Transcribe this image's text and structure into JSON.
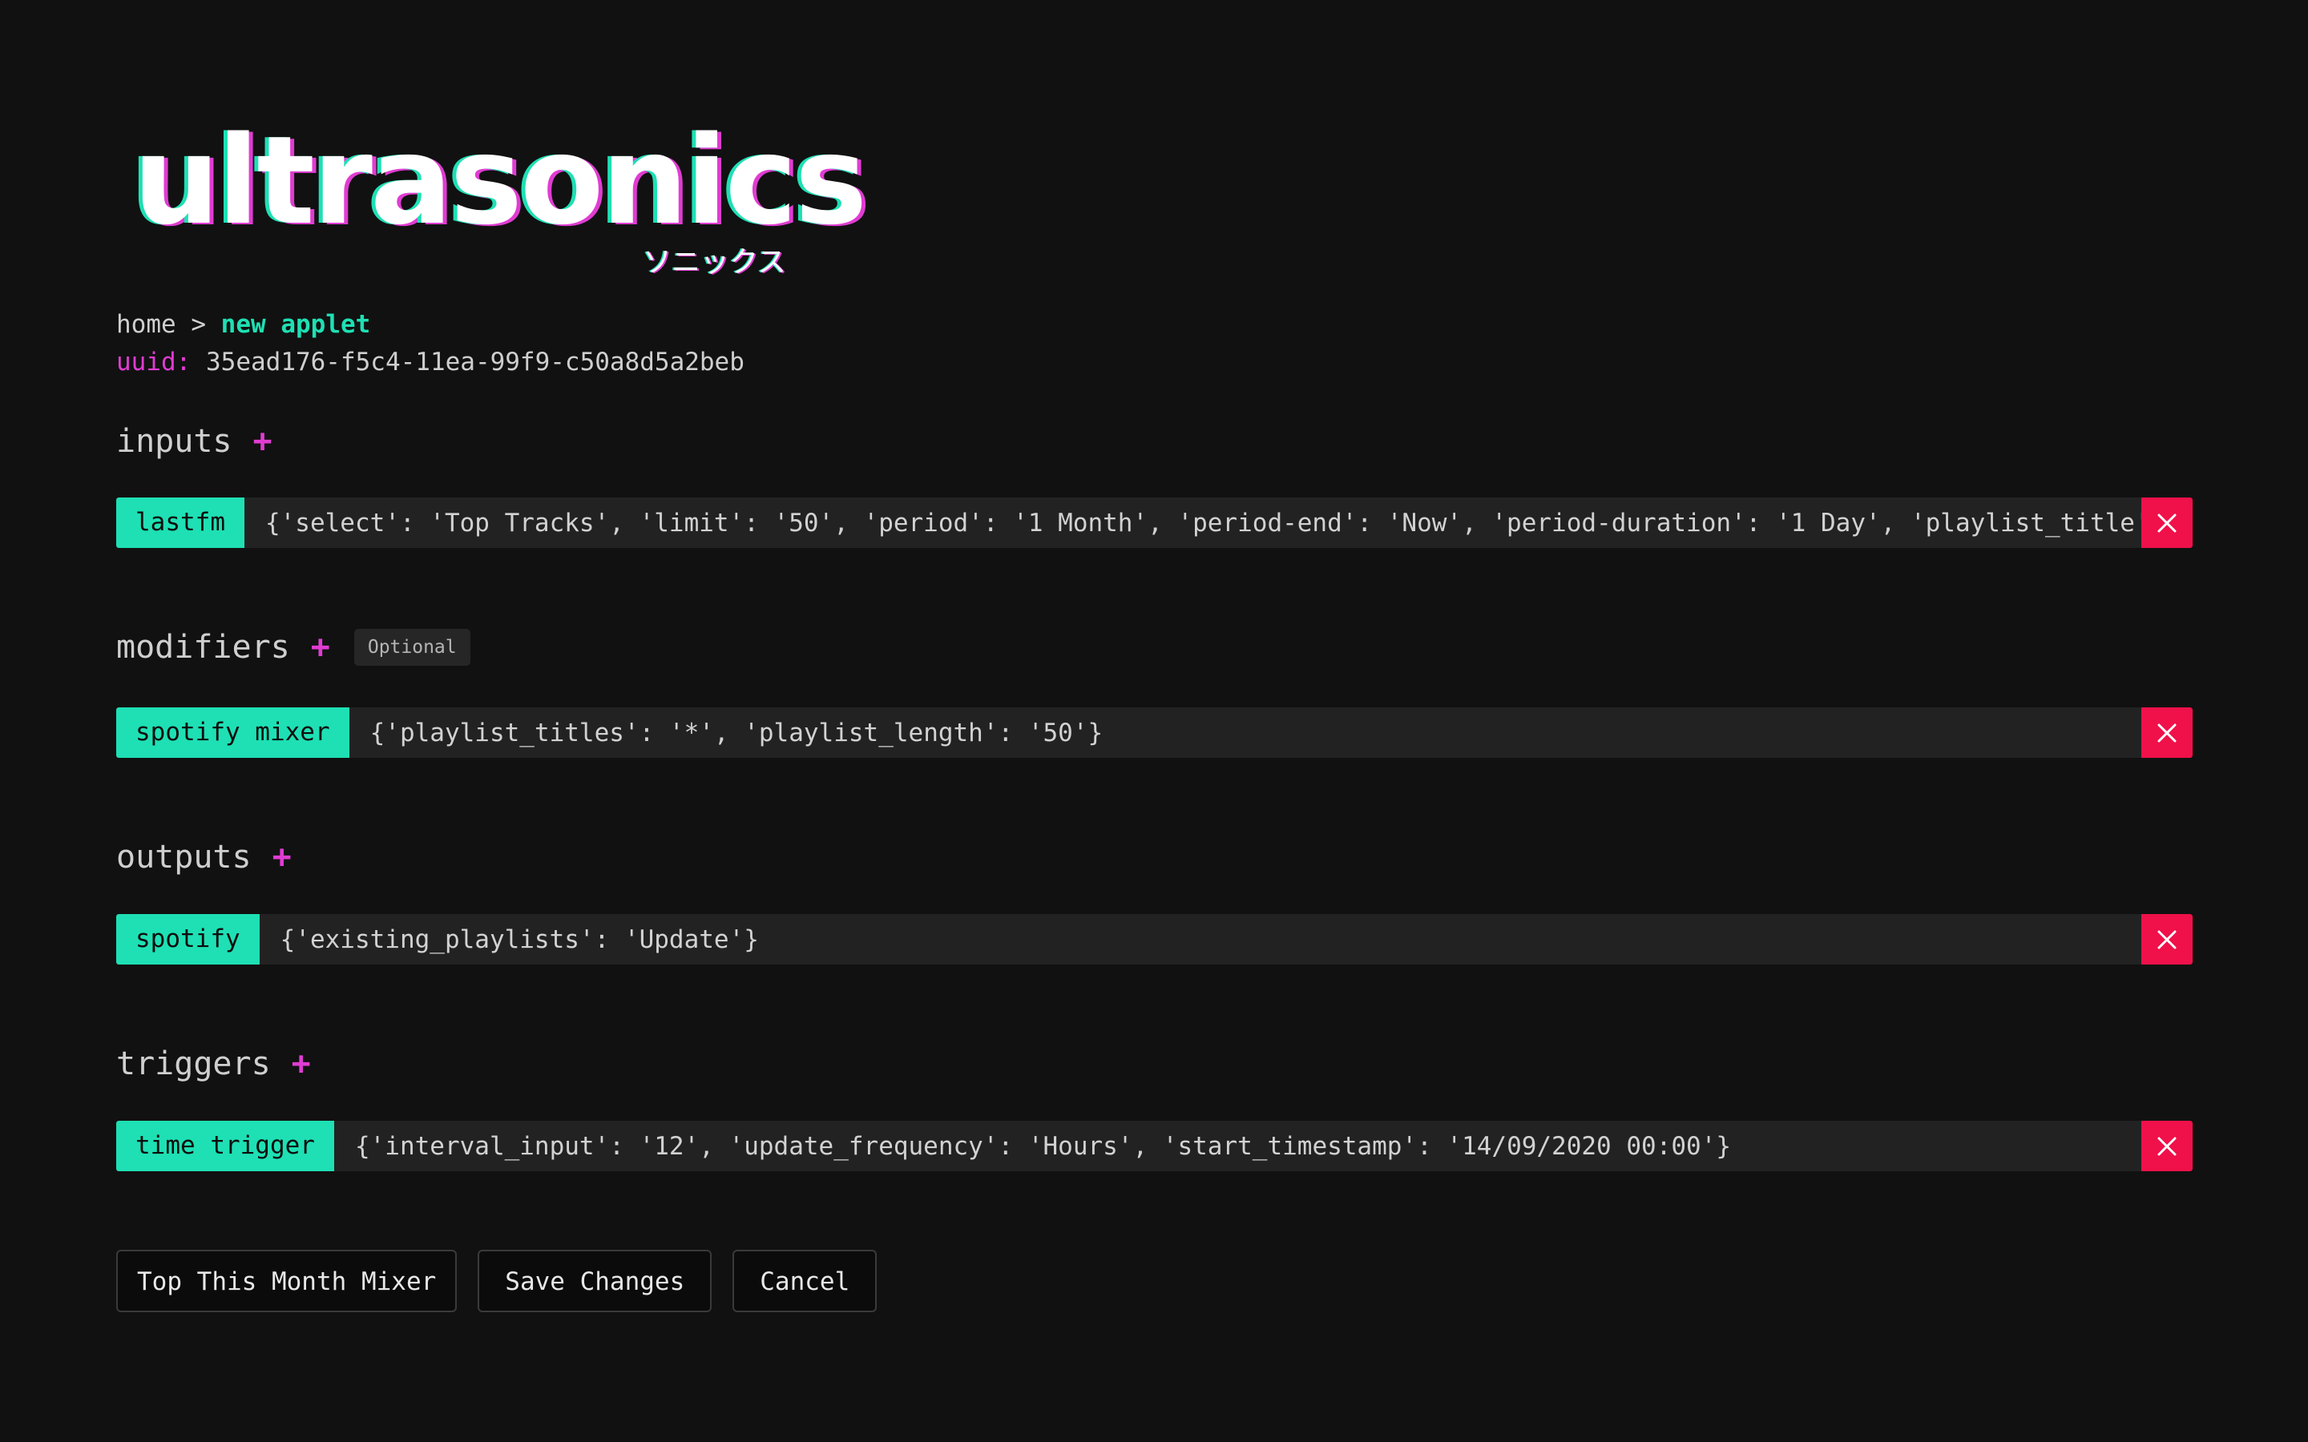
{
  "logo": {
    "word": "ultrasonics",
    "subtitle": "ソニックス"
  },
  "breadcrumb": {
    "home": "home",
    "separator": ">",
    "current": "new applet"
  },
  "uuid": {
    "label": "uuid:",
    "value": "35ead176-f5c4-11ea-99f9-c50a8d5a2beb"
  },
  "sections": {
    "inputs": {
      "title": "inputs",
      "add": "+",
      "items": [
        {
          "tag": "lastfm",
          "value": "{'select': 'Top Tracks', 'limit': '50', 'period': '1 Month', 'period-end': 'Now', 'period-duration': '1 Day', 'playlist_title': 'Top This Month'}"
        }
      ]
    },
    "modifiers": {
      "title": "modifiers",
      "add": "+",
      "badge": "Optional",
      "items": [
        {
          "tag": "spotify mixer",
          "value": "{'playlist_titles': '*', 'playlist_length': '50'}"
        }
      ]
    },
    "outputs": {
      "title": "outputs",
      "add": "+",
      "items": [
        {
          "tag": "spotify",
          "value": "{'existing_playlists': 'Update'}"
        }
      ]
    },
    "triggers": {
      "title": "triggers",
      "add": "+",
      "items": [
        {
          "tag": "time trigger",
          "value": "{'interval_input': '12', 'update_frequency': 'Hours', 'start_timestamp': '14/09/2020 00:00'}"
        }
      ]
    }
  },
  "actions": {
    "applet_name": "Top This Month Mixer",
    "save": "Save Changes",
    "cancel": "Cancel"
  },
  "colors": {
    "background": "#111111",
    "accent_teal": "#1ee0b4",
    "accent_magenta": "#e03cd2",
    "remove_red": "#f0104a",
    "row_background": "#222222"
  }
}
